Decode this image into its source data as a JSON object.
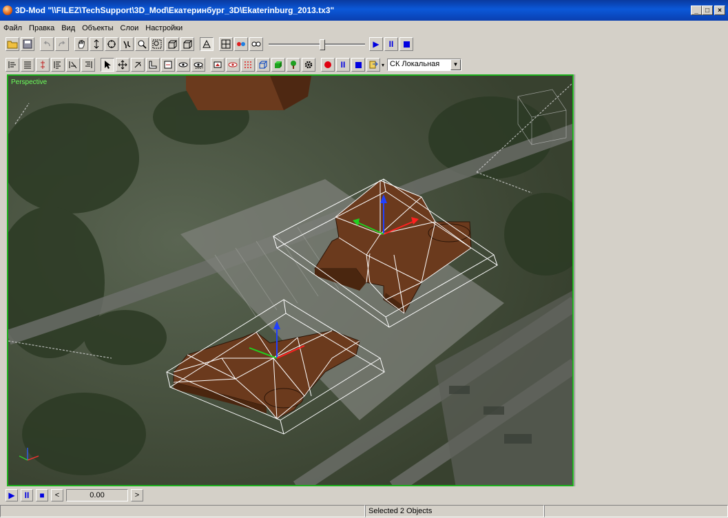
{
  "window": {
    "title": "3D-Mod \"\\\\FILEZ\\TechSupport\\3D_Mod\\Екатеринбург_3D\\Ekaterinburg_2013.tx3\"",
    "app_icon": "globe-icon",
    "controls": [
      "_",
      "□",
      "×"
    ]
  },
  "menu": {
    "items": [
      "Файл",
      "Правка",
      "Вид",
      "Объекты",
      "Слои",
      "Настройки"
    ]
  },
  "toolbar1": {
    "icons": [
      "open-folder-icon",
      "save-icon",
      "undo-icon",
      "redo-icon",
      "pan-hand-icon",
      "zoom-step-icon",
      "orbit-icon",
      "walk-icon",
      "zoom-icon",
      "zoom-region-icon",
      "box-view-icon",
      "box-view-alt-icon",
      "wireframe-icon",
      "grid-icon",
      "color-eye-icon",
      "goggles-icon"
    ],
    "animation_slider_value": 0.55,
    "play_icon": "play-icon",
    "pause_icon": "pause-icon",
    "stop_icon": "stop-icon"
  },
  "toolbar2": {
    "icons": [
      "align-left-icon",
      "align-list-icon",
      "align-vertical-icon",
      "text-align-icon",
      "text-align-alt-icon",
      "text-align-right-icon",
      "select-arrow-icon",
      "move-icon",
      "rotate-icon",
      "ruler-icon",
      "layer-eye-icon",
      "eye-icon",
      "texture-icon",
      "render-icon",
      "record-eye-icon",
      "points-icon",
      "cube-icon",
      "solid-cube-icon",
      "tree-icon",
      "gear-icon"
    ],
    "record_icon": "record-icon",
    "pause_icon": "pause-icon",
    "stop_icon": "stop-icon",
    "export_icon": "export-icon",
    "coord_system": "СК Локальная"
  },
  "viewport": {
    "label": "Perspective",
    "border_color": "#1cb01c",
    "model_color": "#6b3a1d",
    "wire_color": "#ffffff"
  },
  "playback": {
    "play": "▶",
    "pause": "II",
    "stop": "■",
    "prev": "<",
    "frame_value": "0.00",
    "next": ">"
  },
  "status": {
    "left": "",
    "message": "Selected 2 Objects",
    "right": ""
  }
}
